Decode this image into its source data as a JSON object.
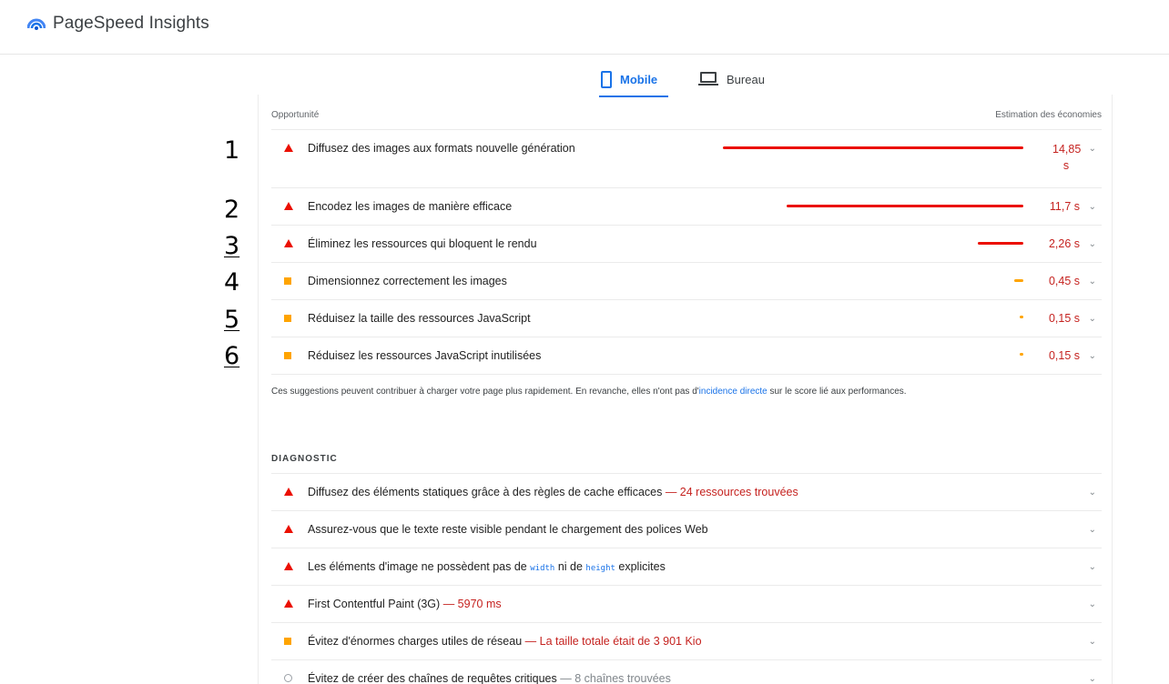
{
  "header": {
    "app_title": "PageSpeed Insights"
  },
  "tabs": [
    {
      "label": "Mobile",
      "active": true
    },
    {
      "label": "Bureau",
      "active": false
    }
  ],
  "opportunities": {
    "column_left": "Opportunité",
    "column_right": "Estimation des économies",
    "items": [
      {
        "title": "Diffusez des images aux formats nouvelle génération",
        "saving_line1": "14,85",
        "saving_line2": "s",
        "severity": "fail",
        "bar_fraction": 1.0
      },
      {
        "title": "Encodez les images de manière efficace",
        "saving": "11,7 s",
        "severity": "fail",
        "bar_fraction": 0.788
      },
      {
        "title": "Éliminez les ressources qui bloquent le rendu",
        "saving": "2,26 s",
        "severity": "fail",
        "bar_fraction": 0.152
      },
      {
        "title": "Dimensionnez correctement les images",
        "saving": "0,45 s",
        "severity": "average",
        "bar_fraction": 0.03
      },
      {
        "title": "Réduisez la taille des ressources JavaScript",
        "saving": "0,15 s",
        "severity": "average",
        "bar_fraction": 0.01
      },
      {
        "title": "Réduisez les ressources JavaScript inutilisées",
        "saving": "0,15 s",
        "severity": "average",
        "bar_fraction": 0.01
      }
    ],
    "note_before": "Ces suggestions peuvent contribuer à charger votre page plus rapidement. En revanche, elles n'ont pas d'",
    "note_link": "incidence directe",
    "note_after": " sur le score lié aux performances."
  },
  "diagnostic": {
    "heading": "DIAGNOSTIC",
    "items": [
      {
        "title": "Diffusez des éléments statiques grâce à des règles de cache efficaces",
        "detail": "— 24 ressources trouvées",
        "severity": "fail"
      },
      {
        "title": "Assurez-vous que le texte reste visible pendant le chargement des polices Web",
        "severity": "fail"
      },
      {
        "title_before": "Les éléments d'image ne possèdent pas de",
        "code1": "width",
        "title_mid": "ni de",
        "code2": "height",
        "title_after": "explicites",
        "severity": "fail"
      },
      {
        "title": "First Contentful Paint (3G)",
        "detail": "— 5970 ms",
        "severity": "fail"
      },
      {
        "title": "Évitez d'énormes charges utiles de réseau",
        "detail": "— La taille totale était de 3 901 Kio",
        "severity": "average"
      },
      {
        "title": "Évitez de créer des chaînes de requêtes critiques",
        "detail": "— 8 chaînes trouvées",
        "severity": "info"
      }
    ]
  },
  "annotations": [
    "1",
    "2",
    "3",
    "4",
    "5",
    "6"
  ],
  "colors": {
    "fail": "#eb0f00",
    "average": "#ffa400",
    "accent": "#1a73e8"
  }
}
